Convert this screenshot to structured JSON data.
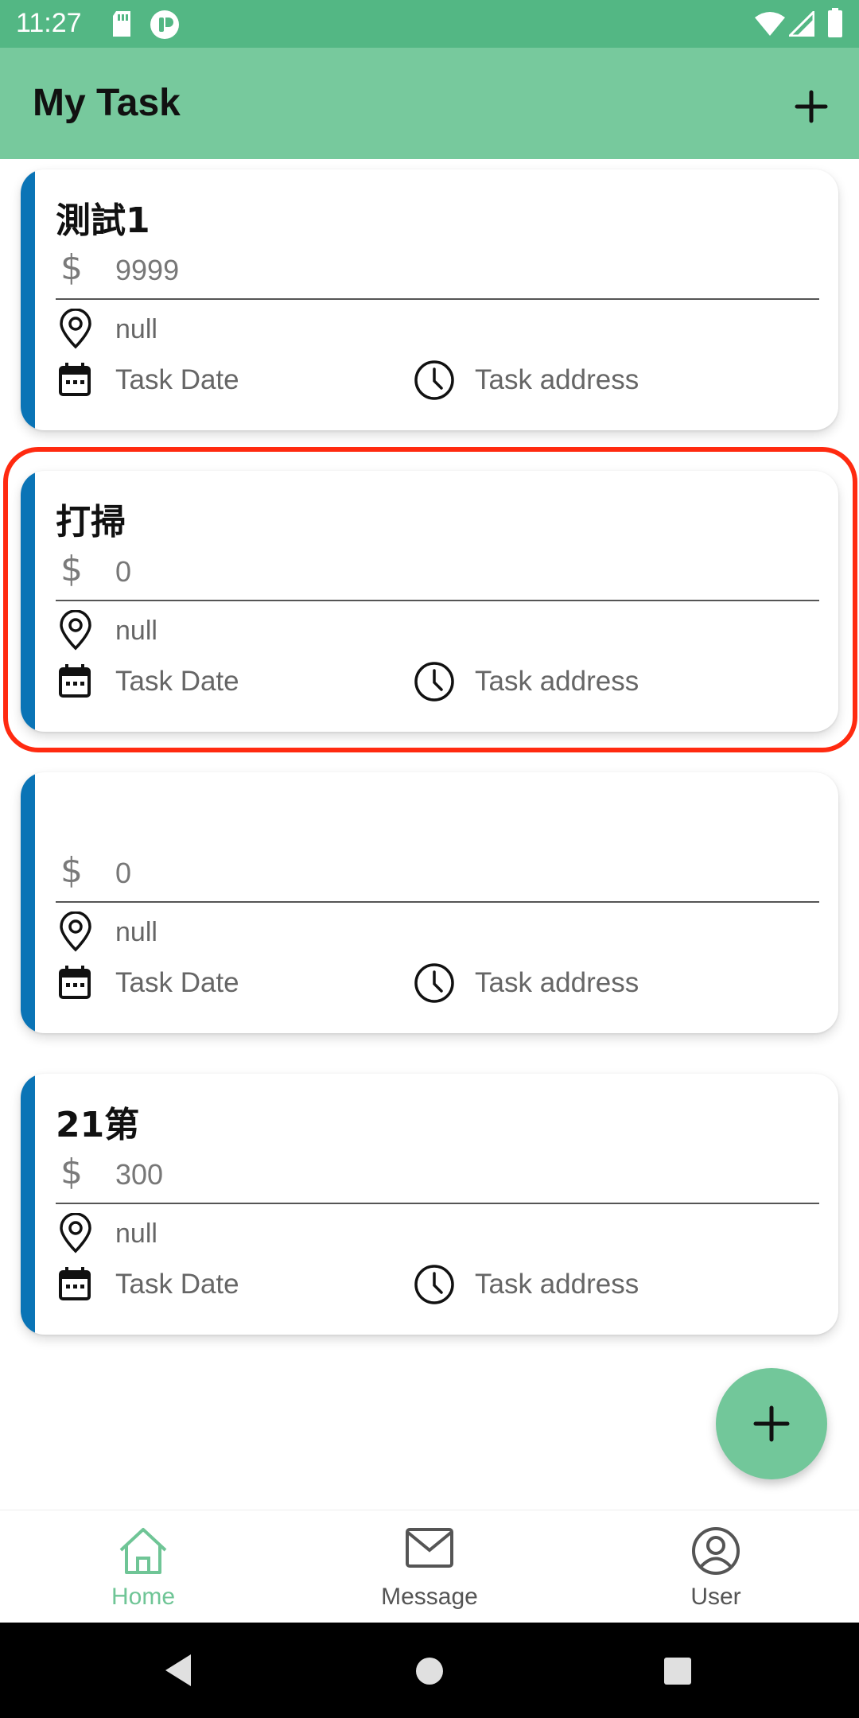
{
  "status_bar": {
    "time": "11:27",
    "icons": [
      "sd-card-icon",
      "app-notification-icon",
      "wifi-icon",
      "signal-icon",
      "battery-icon"
    ]
  },
  "app_bar": {
    "title": "My Task",
    "add_icon": "plus-icon"
  },
  "colors": {
    "status_bar": "#53b784",
    "app_bar": "#77c99d",
    "card_accent": "#0a74b6",
    "active_nav": "#6fc596",
    "highlight": "#ff2a10",
    "fab": "#72c79a"
  },
  "tasks": [
    {
      "title": "測試1",
      "price_symbol": "$",
      "price": "9999",
      "location": "null",
      "date": "Task Date",
      "address": "Task address"
    },
    {
      "title": "打掃",
      "price_symbol": "$",
      "price": "0",
      "location": "null",
      "date": "Task Date",
      "address": "Task address"
    },
    {
      "title": "",
      "price_symbol": "$",
      "price": "0",
      "location": "null",
      "date": "Task Date",
      "address": "Task address"
    },
    {
      "title": "21第",
      "price_symbol": "$",
      "price": "300",
      "location": "null",
      "date": "Task Date",
      "address": "Task address"
    }
  ],
  "fab": {
    "icon": "plus-icon"
  },
  "bottom_nav": {
    "items": [
      {
        "label": "Home",
        "icon": "home-icon",
        "active": true
      },
      {
        "label": "Message",
        "icon": "mail-icon",
        "active": false
      },
      {
        "label": "User",
        "icon": "user-icon",
        "active": false
      }
    ]
  },
  "system_nav": [
    "back-icon",
    "home-circle-icon",
    "recents-icon"
  ]
}
